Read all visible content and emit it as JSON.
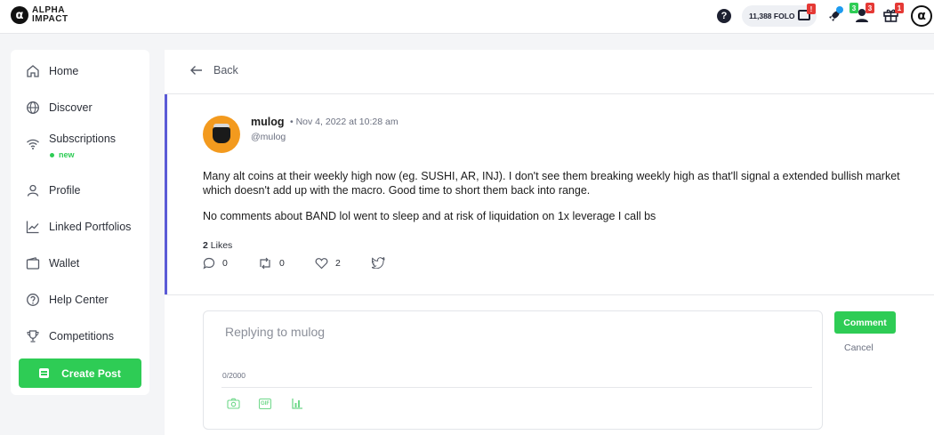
{
  "header": {
    "logo_mark": "α",
    "logo_line1": "ALPHA",
    "logo_line2": "IMPACT",
    "help_glyph": "?",
    "folo_balance": "11,388 FOLO",
    "wallet_badge": "!",
    "rocket_badge": "3",
    "notifications_badge": "3",
    "gift_badge": "1",
    "profile_glyph": "α"
  },
  "sidebar": {
    "items": [
      {
        "label": "Home",
        "icon": "home-icon"
      },
      {
        "label": "Discover",
        "icon": "globe-icon"
      },
      {
        "label": "Subscriptions",
        "icon": "wifi-icon"
      },
      {
        "label": "Profile",
        "icon": "user-icon"
      },
      {
        "label": "Linked Portfolios",
        "icon": "chart-line-icon"
      },
      {
        "label": "Wallet",
        "icon": "wallet-icon"
      },
      {
        "label": "Help Center",
        "icon": "help-circle-icon"
      },
      {
        "label": "Competitions",
        "icon": "trophy-icon"
      }
    ],
    "subscriptions_tag": "new",
    "create_post_label": "Create Post"
  },
  "main": {
    "back_label": "Back",
    "post": {
      "username": "mulog",
      "timestamp": "• Nov 4, 2022 at 10:28 am",
      "handle": "@mulog",
      "paragraph1": "Many alt coins at their weekly high now (eg. SUSHI, AR, INJ). I don't see them breaking weekly high as that'll signal a extended bullish market which doesn't add up with the macro. Good time to short them back into range.",
      "paragraph2": "No comments about BAND lol went to sleep and at risk of liquidation on 1x leverage I call bs",
      "likes_count": "2",
      "likes_label": "Likes",
      "comments_count": "0",
      "reposts_count": "0",
      "hearts_count": "2"
    },
    "reply": {
      "placeholder": "Replying to mulog",
      "counter": "0/2000",
      "gif_label": "GIF",
      "comment_label": "Comment",
      "cancel_label": "Cancel"
    }
  },
  "colors": {
    "accent": "#2ecc55",
    "post_border": "#5b5bd6",
    "badge_red": "#e53935"
  }
}
